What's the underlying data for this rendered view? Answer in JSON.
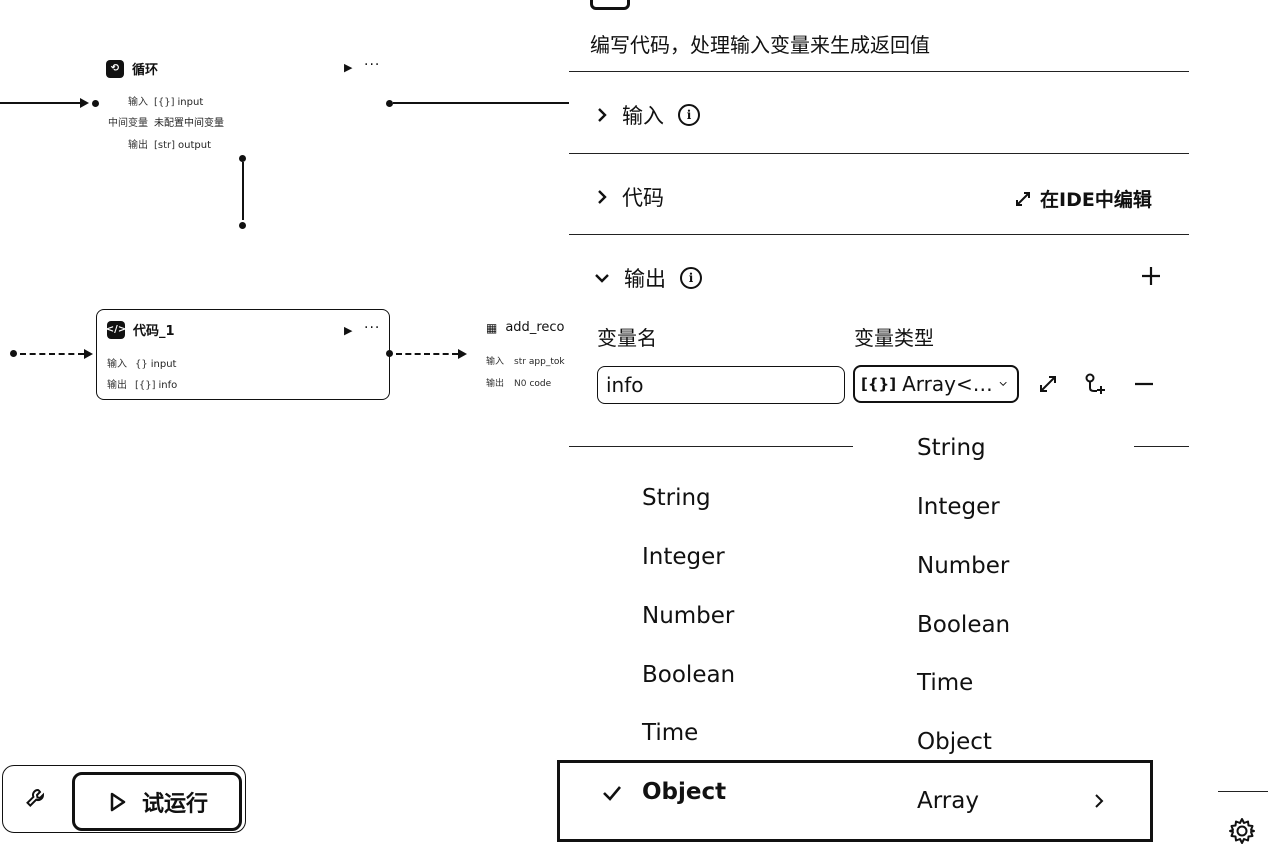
{
  "canvas": {
    "loop_node": {
      "title": "循环",
      "rows": [
        {
          "key": "输入",
          "type": "[{}]",
          "value": "input"
        },
        {
          "key": "中间变量",
          "type": "",
          "value": "未配置中间变量"
        },
        {
          "key": "输出",
          "type": "[str]",
          "value": "output"
        }
      ]
    },
    "code_node": {
      "title": "代码_1",
      "rows": [
        {
          "key": "输入",
          "type": "{}",
          "value": "input"
        },
        {
          "key": "输出",
          "type": "[{}]",
          "value": "info"
        }
      ]
    },
    "add_node": {
      "title": "add_reco",
      "rows": [
        {
          "key": "输入",
          "type": "str",
          "value": "app_tok"
        },
        {
          "key": "输出",
          "type": "N0",
          "value": "code"
        }
      ]
    },
    "toolbar": {
      "run_label": "试运行"
    }
  },
  "panel": {
    "description": "编写代码，处理输入变量来生成返回值",
    "sections": {
      "input": "输入",
      "code": "代码",
      "edit_in_ide": "在IDE中编辑",
      "output": "输出"
    },
    "output_table": {
      "col_name": "变量名",
      "col_type": "变量类型",
      "row": {
        "name": "info",
        "type": "Array<…"
      }
    },
    "type_menu": {
      "items": [
        "String",
        "Integer",
        "Number",
        "Boolean",
        "Time",
        "Object"
      ],
      "selected": "Object"
    },
    "sub_menu": {
      "items": [
        "String",
        "Integer",
        "Number",
        "Boolean",
        "Time",
        "Object",
        "Array"
      ]
    }
  },
  "icons": {
    "collapse": "chevron-right-icon",
    "expand": "chevron-down-icon",
    "info": "info-icon",
    "add": "plus-icon",
    "expand_editor": "expand-diagonal-icon",
    "settings": "gear-icon",
    "wrench": "wrench-icon",
    "play": "play-icon",
    "check": "check-icon"
  }
}
